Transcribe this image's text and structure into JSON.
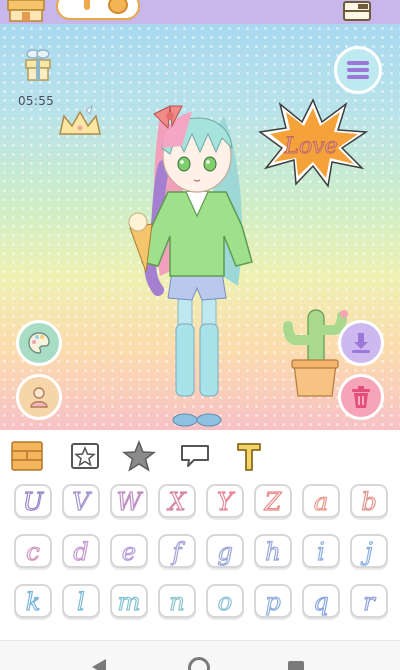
{
  "app": {
    "timer_text": "05:55",
    "sticker_text": "Love"
  },
  "colors": {
    "top_bar": "#c9b6ea",
    "letter_fill": "#ffffff"
  },
  "icons": {
    "top_left": "shop-icon",
    "currency": "coin-icon",
    "top_right": "wardrobe-icon",
    "gift": "gift-box-icon",
    "menu": "menu-icon",
    "palette": "palette-icon",
    "person": "person-icon",
    "download": "download-icon",
    "trash": "trash-icon"
  },
  "category_tabs": [
    {
      "icon": "shelf-icon",
      "selected": true
    },
    {
      "icon": "star-box-icon",
      "selected": false
    },
    {
      "icon": "star-icon",
      "selected": false
    },
    {
      "icon": "speech-bubble-icon",
      "selected": false
    },
    {
      "icon": "letter-t-icon",
      "selected": false
    }
  ],
  "letter_rows": [
    [
      {
        "char": "U",
        "color": "#9a88c9"
      },
      {
        "char": "V",
        "color": "#a596d2"
      },
      {
        "char": "W",
        "color": "#c08fc4"
      },
      {
        "char": "X",
        "color": "#d88aa4"
      },
      {
        "char": "Y",
        "color": "#e78b9a"
      },
      {
        "char": "Z",
        "color": "#e88a8a"
      },
      {
        "char": "a",
        "color": "#e99f8e"
      },
      {
        "char": "b",
        "color": "#e1988f"
      }
    ],
    [
      {
        "char": "c",
        "color": "#d49ac0"
      },
      {
        "char": "d",
        "color": "#c79ad2"
      },
      {
        "char": "e",
        "color": "#b49ed9"
      },
      {
        "char": "f",
        "color": "#a7a3d9"
      },
      {
        "char": "g",
        "color": "#9ba8d6"
      },
      {
        "char": "h",
        "color": "#97a9db"
      },
      {
        "char": "i",
        "color": "#8fb0dd"
      },
      {
        "char": "j",
        "color": "#87b0e0"
      }
    ],
    [
      {
        "char": "k",
        "color": "#7fb6dd"
      },
      {
        "char": "l",
        "color": "#7fbdd6"
      },
      {
        "char": "m",
        "color": "#86c3d2"
      },
      {
        "char": "n",
        "color": "#8ec6cd"
      },
      {
        "char": "o",
        "color": "#92c1d9"
      },
      {
        "char": "p",
        "color": "#8fb0e0"
      },
      {
        "char": "q",
        "color": "#8aa6e2"
      },
      {
        "char": "r",
        "color": "#93a3dc"
      }
    ]
  ]
}
